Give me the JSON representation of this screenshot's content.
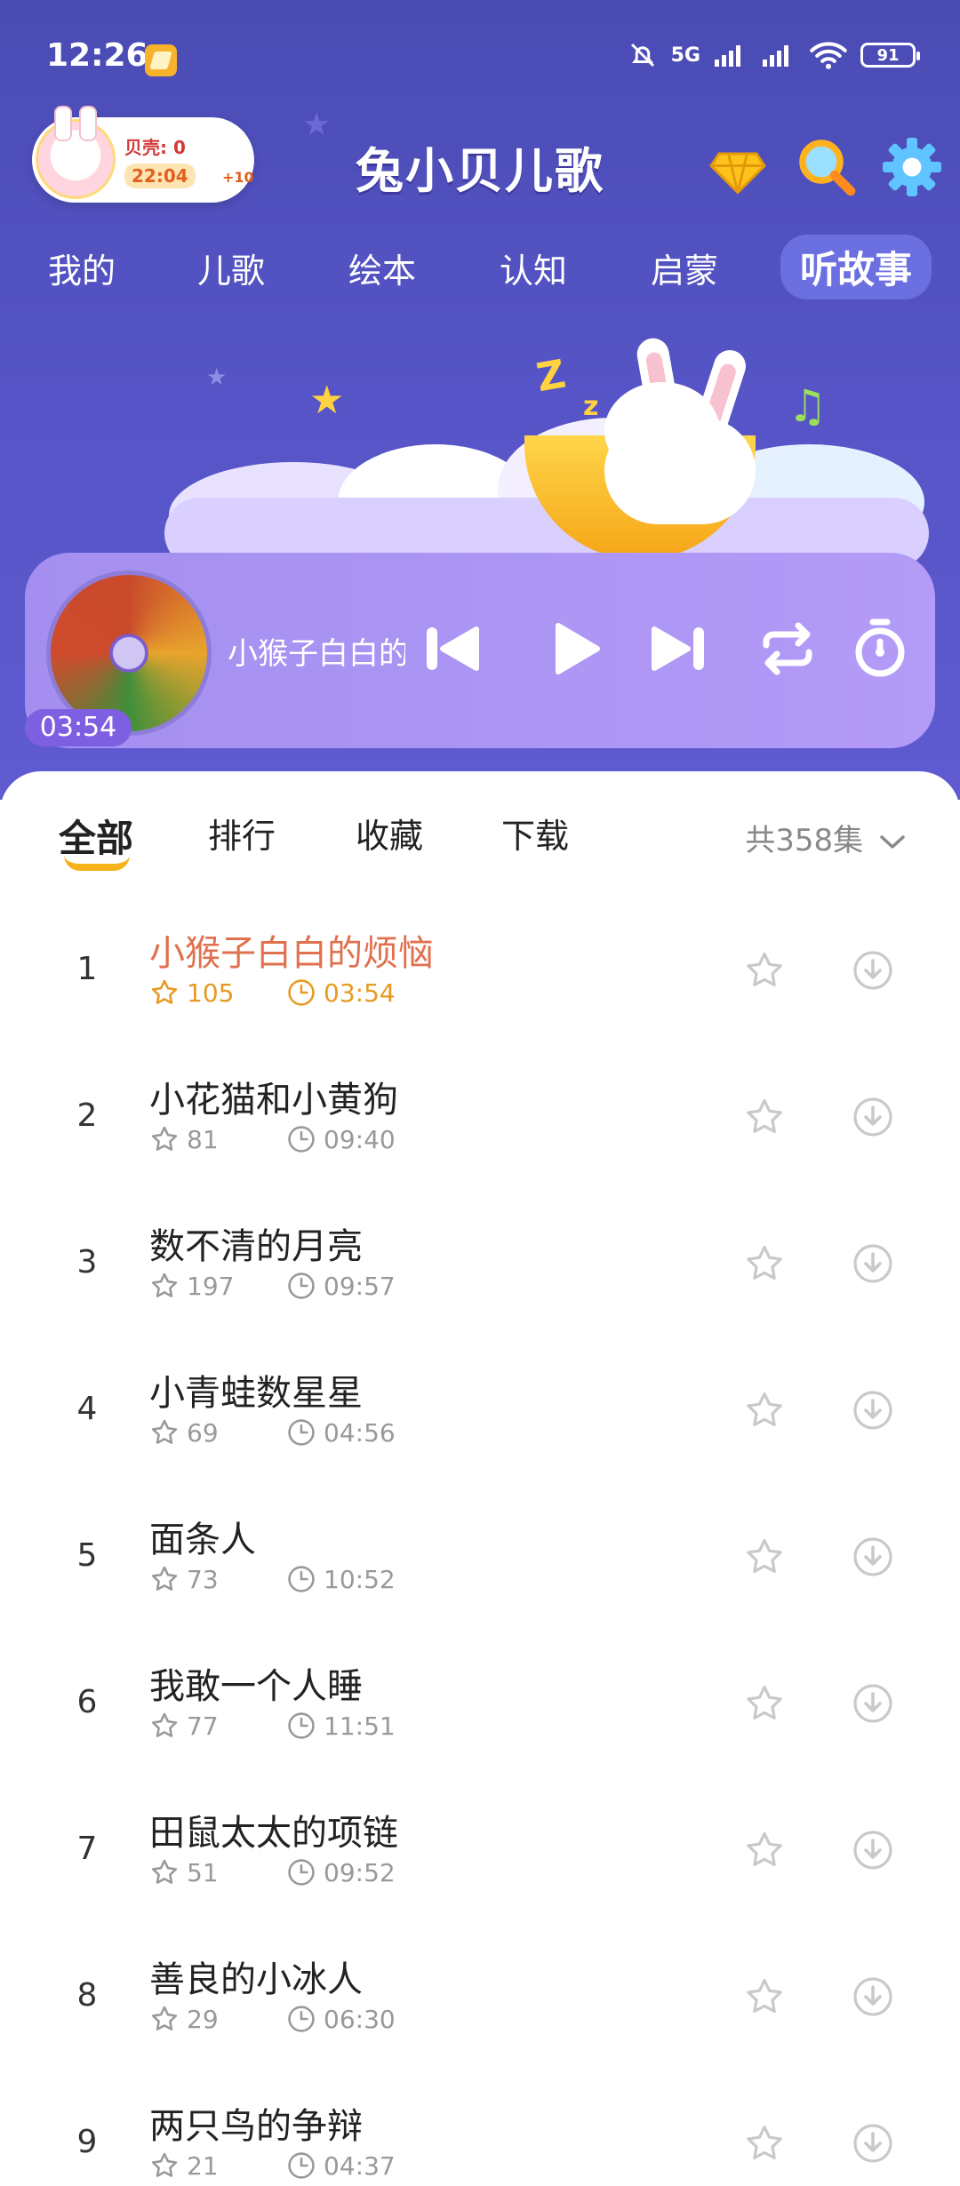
{
  "status_bar": {
    "time": "12:26",
    "network": "5G",
    "battery": "91"
  },
  "header": {
    "beike_label": "贝壳: 0",
    "timer": "22:04",
    "plus": "+10",
    "logo": "兔小贝儿歌"
  },
  "nav_tabs": [
    {
      "label": "我的"
    },
    {
      "label": "儿歌"
    },
    {
      "label": "绘本"
    },
    {
      "label": "认知"
    },
    {
      "label": "启蒙"
    },
    {
      "label": "听故事"
    }
  ],
  "player": {
    "now_playing": "小猴子白白的烦恼",
    "elapsed": "03:54"
  },
  "sub_tabs": [
    {
      "label": "全部"
    },
    {
      "label": "排行"
    },
    {
      "label": "收藏"
    },
    {
      "label": "下载"
    }
  ],
  "episode_count": "共358集",
  "stories": [
    {
      "num": "1",
      "title": "小猴子白白的烦恼",
      "likes": "105",
      "duration": "03:54"
    },
    {
      "num": "2",
      "title": "小花猫和小黄狗",
      "likes": "81",
      "duration": "09:40"
    },
    {
      "num": "3",
      "title": "数不清的月亮",
      "likes": "197",
      "duration": "09:57"
    },
    {
      "num": "4",
      "title": "小青蛙数星星",
      "likes": "69",
      "duration": "04:56"
    },
    {
      "num": "5",
      "title": "面条人",
      "likes": "73",
      "duration": "10:52"
    },
    {
      "num": "6",
      "title": "我敢一个人睡",
      "likes": "77",
      "duration": "11:51"
    },
    {
      "num": "7",
      "title": "田鼠太太的项链",
      "likes": "51",
      "duration": "09:52"
    },
    {
      "num": "8",
      "title": "善良的小冰人",
      "likes": "29",
      "duration": "06:30"
    },
    {
      "num": "9",
      "title": "两只鸟的争辩",
      "likes": "21",
      "duration": "04:37"
    }
  ],
  "colors": {
    "hero": "#5453c4",
    "player": "#a995f3",
    "active_text": "#e0714f",
    "accent": "#f5b21a"
  }
}
